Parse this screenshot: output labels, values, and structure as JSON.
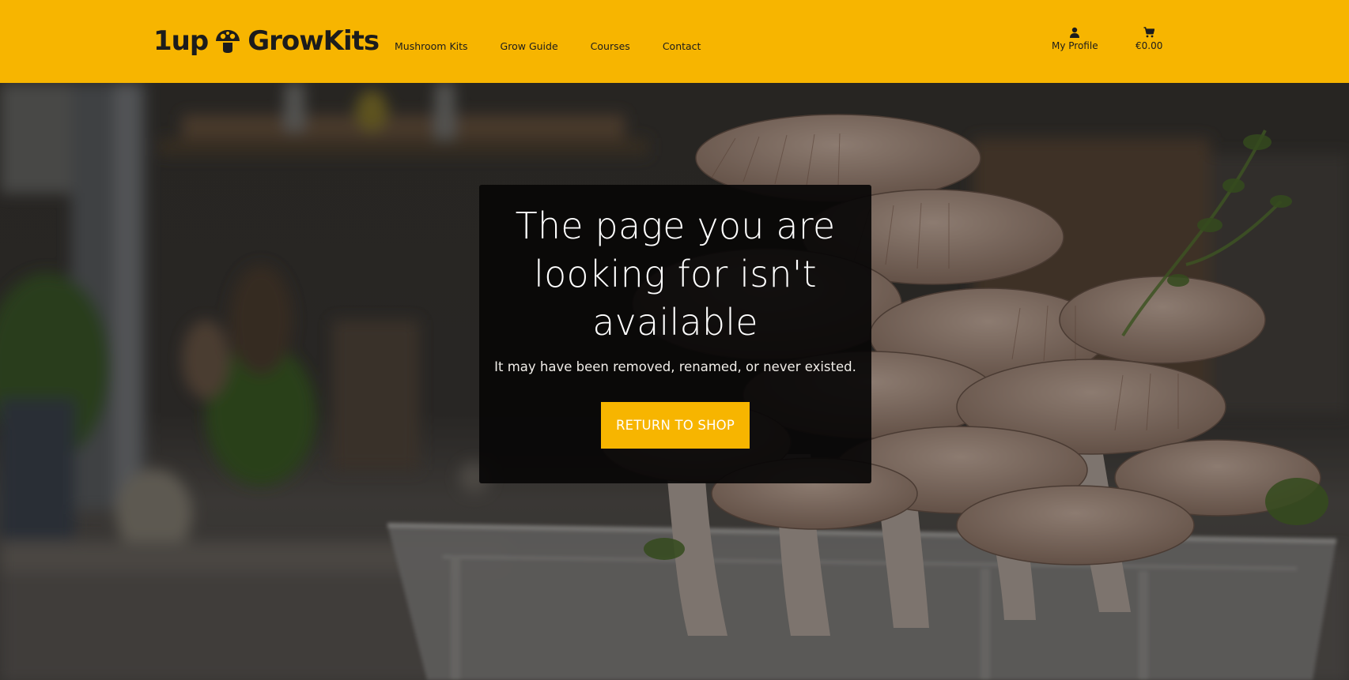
{
  "brand": {
    "logo_text": "1up GrowKits",
    "logo_before": "1up",
    "logo_after": "GrowKits",
    "accent_color": "#f7b500"
  },
  "nav": {
    "items": [
      {
        "label": "Mushroom Kits"
      },
      {
        "label": "Grow Guide"
      },
      {
        "label": "Courses"
      },
      {
        "label": "Contact"
      }
    ]
  },
  "header_actions": {
    "profile_label": "My Profile",
    "profile_icon": "user-icon",
    "cart_total": "€0.00",
    "cart_icon": "cart-icon"
  },
  "error_card": {
    "title": "The page you are looking for isn't available",
    "message": "It may have been removed, renamed, or never existed.",
    "button_label": "RETURN TO SHOP"
  }
}
